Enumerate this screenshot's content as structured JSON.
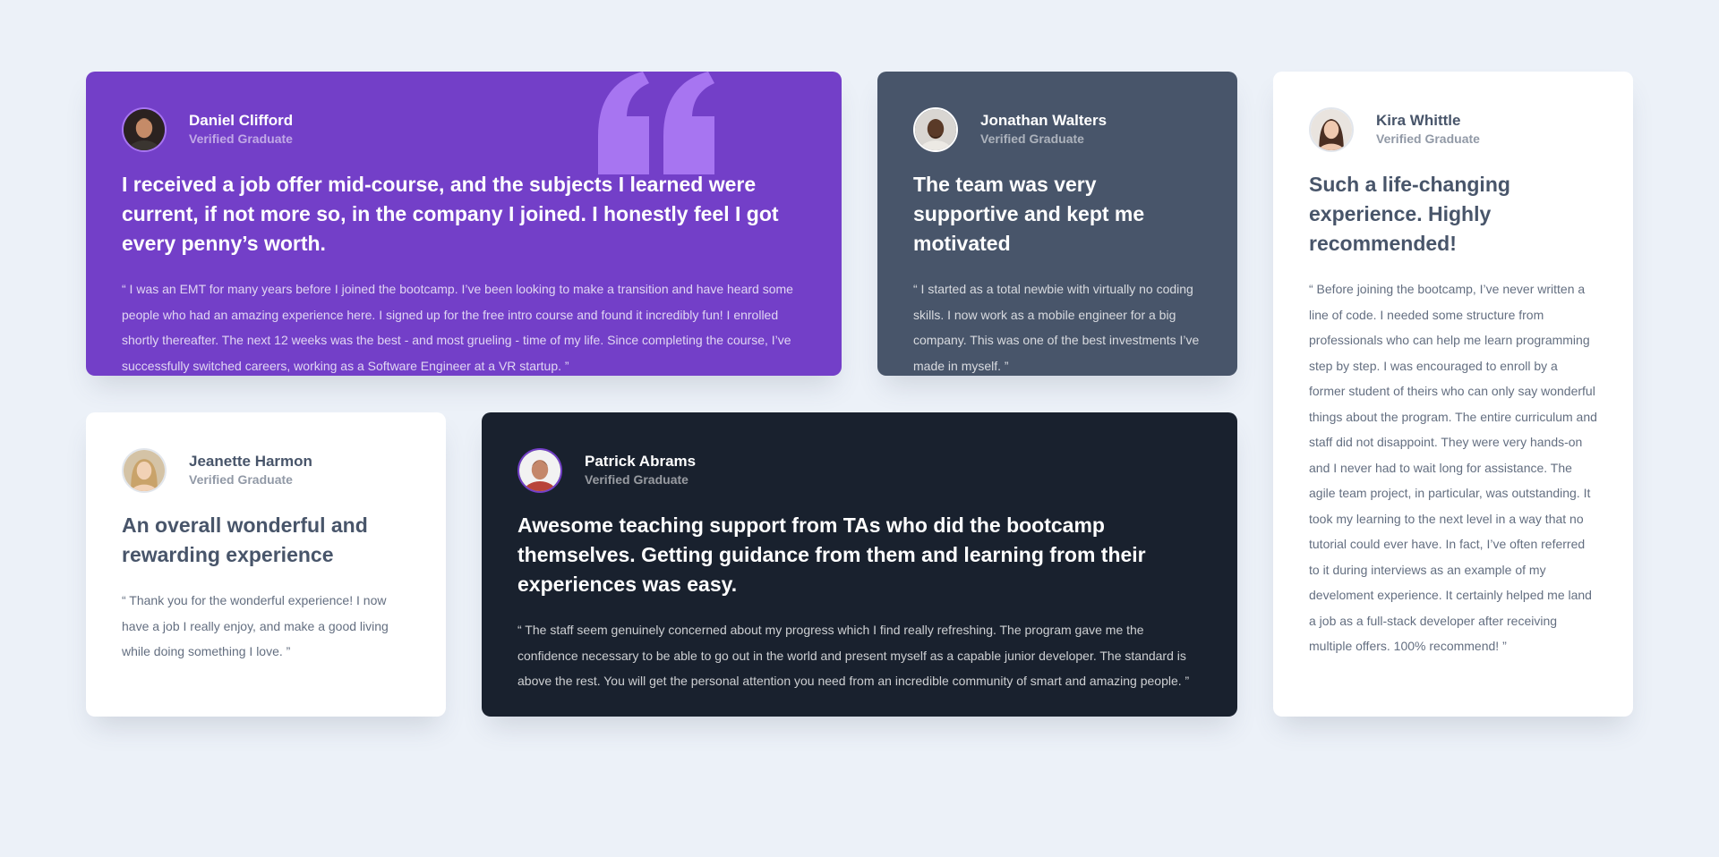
{
  "testimonials": [
    {
      "name": "Daniel Clifford",
      "role": "Verified Graduate",
      "headline": "I received a job offer mid-course, and the subjects I learned were current, if not more so, in the company I joined. I honestly feel I got every penny’s worth.",
      "quote": "“ I was an EMT for many years before I joined the bootcamp. I’ve been looking to make a transition and have heard some people who had an amazing experience here. I signed up for the free intro course and found it incredibly fun! I enrolled shortly thereafter. The next 12 weeks was the best - and most grueling - time of my life. Since completing the course, I’ve successfully switched careers, working as a Software Engineer at a VR startup. ”",
      "card_color": "#733fc8"
    },
    {
      "name": "Jonathan Walters",
      "role": "Verified Graduate",
      "headline": "The team was very supportive and kept me motivated",
      "quote": "“ I started as a total newbie with virtually no coding skills. I now work as a mobile engineer for a big company. This was one of the best investments I’ve made in myself. ”",
      "card_color": "#48556a"
    },
    {
      "name": "Kira Whittle",
      "role": "Verified Graduate",
      "headline": "Such a life-changing experience. Highly recommended!",
      "quote": "“ Before joining the bootcamp, I’ve never written a line of code. I needed some structure from professionals who can help me learn programming step by step. I was encouraged to enroll by a former student of theirs who can only say wonderful things about the program. The entire curriculum and staff did not disappoint. They were very hands-on and I never had to wait long for assistance. The agile team project, in particular, was outstanding. It took my learning to the next level in a way that no tutorial could ever have. In fact, I’ve often referred to it during interviews as an example of my develoment experience. It certainly helped me land a job as a full-stack developer after receiving multiple offers. 100% recommend! ”",
      "card_color": "#ffffff"
    },
    {
      "name": "Jeanette Harmon",
      "role": "Verified Graduate",
      "headline": "An overall wonderful and rewarding experience",
      "quote": "“ Thank you for the wonderful experience! I now have a job I really enjoy, and make a good living while doing something I love. ”",
      "card_color": "#ffffff"
    },
    {
      "name": "Patrick Abrams",
      "role": "Verified Graduate",
      "headline": "Awesome teaching support from TAs who did the bootcamp themselves. Getting guidance from them and learning from their experiences was easy.",
      "quote": "“ The staff seem genuinely concerned about my progress which I find really refreshing. The program gave me the confidence necessary to be able to go out in the world and present myself as a capable junior developer. The standard is above the rest. You will get the personal attention you need from an incredible community of smart and amazing people. ”",
      "card_color": "#19212e"
    }
  ],
  "page_background": "#ecf1f8",
  "quote_mark_icon": "quote-icon"
}
